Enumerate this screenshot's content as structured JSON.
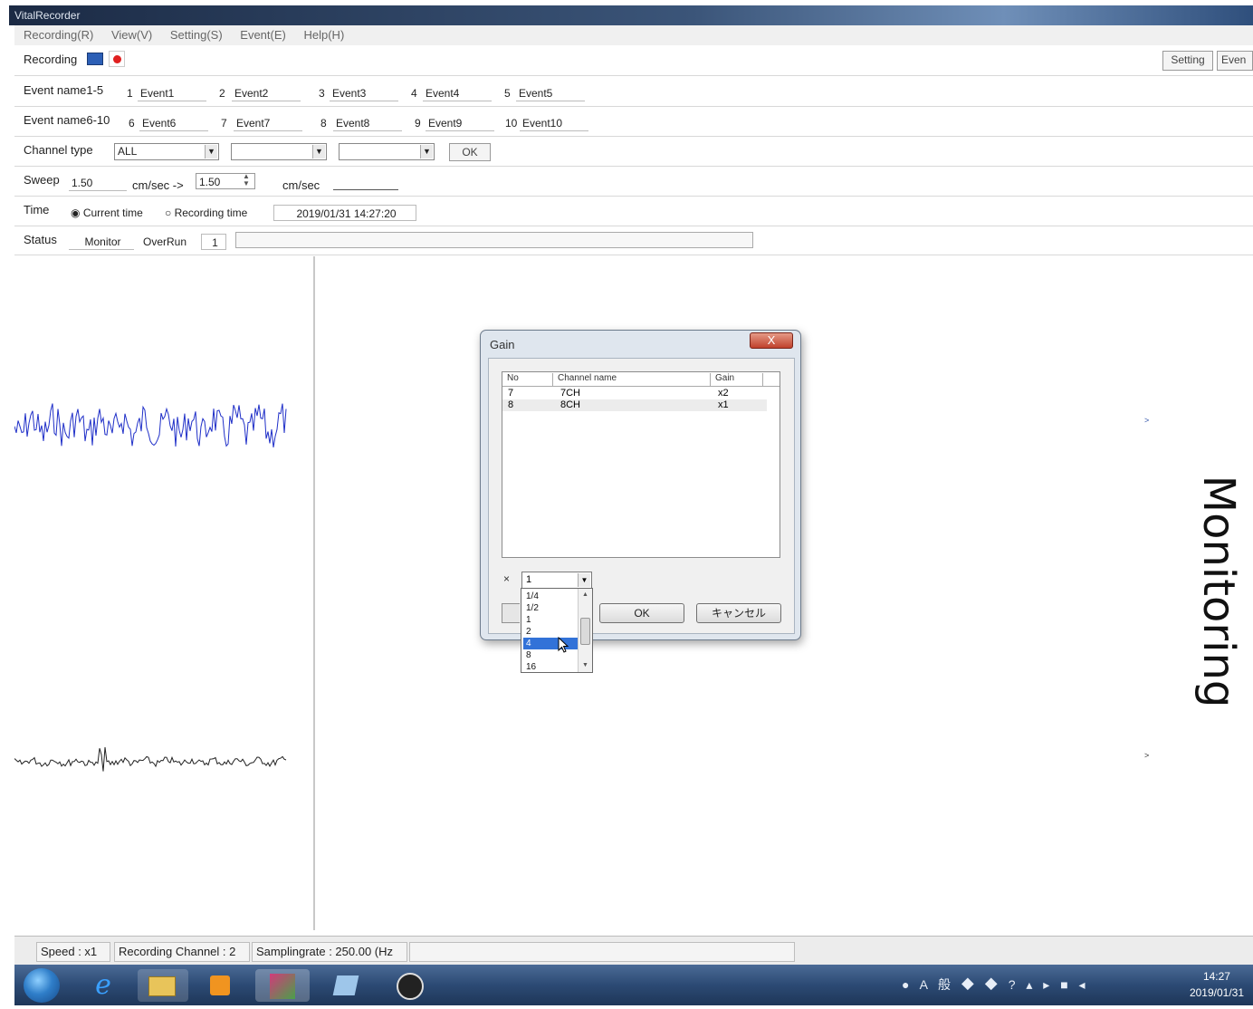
{
  "window": {
    "title": "VitalRecorder"
  },
  "menu": {
    "items": [
      "Recording(R)",
      "View(V)",
      "Setting(S)",
      "Event(E)",
      "Help(H)"
    ]
  },
  "toolbar": {
    "recording_label": "Recording",
    "setting_button": "Setting",
    "event_button": "Even"
  },
  "events_row1": {
    "label": "Event name1-5",
    "items": [
      {
        "num": "1",
        "value": "Event1"
      },
      {
        "num": "2",
        "value": "Event2"
      },
      {
        "num": "3",
        "value": "Event3"
      },
      {
        "num": "4",
        "value": "Event4"
      },
      {
        "num": "5",
        "value": "Event5"
      }
    ]
  },
  "events_row2": {
    "label": "Event name6-10",
    "items": [
      {
        "num": "6",
        "value": "Event6"
      },
      {
        "num": "7",
        "value": "Event7"
      },
      {
        "num": "8",
        "value": "Event8"
      },
      {
        "num": "9",
        "value": "Event9"
      },
      {
        "num": "10",
        "value": "Event10"
      }
    ]
  },
  "channel_type": {
    "label": "Channel type",
    "value1": "ALL",
    "value2": "",
    "value3": "",
    "ok": "OK"
  },
  "sweep": {
    "label": "Sweep",
    "value": "1.50",
    "unit1": "cm/sec ->",
    "new_value": "1.50",
    "unit2": "cm/sec"
  },
  "time": {
    "label": "Time",
    "opt_current": "Current time",
    "opt_recording": "Recording time",
    "value": "2019/01/31 14:27:20"
  },
  "status": {
    "label": "Status",
    "mode": "Monitor",
    "overrun_label": "OverRun",
    "overrun_value": "1"
  },
  "main": {
    "mode_text": "Monitoring",
    "marker1": ">",
    "marker2": ">"
  },
  "dialog": {
    "title": "Gain",
    "close": "X",
    "columns": [
      "No",
      "Channel name",
      "Gain"
    ],
    "rows": [
      {
        "no": "7",
        "name": "7CH",
        "gain": "x2"
      },
      {
        "no": "8",
        "name": "8CH",
        "gain": "x1"
      }
    ],
    "multiplier_label": "×",
    "gain_value": "1",
    "ok": "OK",
    "cancel": "キャンセル"
  },
  "gain_dropdown": {
    "options": [
      "1/4",
      "1/2",
      "1",
      "2",
      "4",
      "8",
      "16"
    ],
    "selected_index": 4
  },
  "statusbar": {
    "speed": "Speed : x1",
    "channel": "Recording Channel : 2",
    "samplingrate": "Samplingrate : 250.00 (Hz"
  },
  "clock": {
    "time": "14:27",
    "date": "2019/01/31"
  },
  "colors": {
    "wave1": "#1f2fc8",
    "wave2": "#222222",
    "selection": "#3272d8"
  },
  "icons": [
    "start-orb-icon",
    "ie-icon",
    "explorer-icon",
    "media-player-icon",
    "app-icon",
    "app2-icon",
    "obs-icon"
  ]
}
